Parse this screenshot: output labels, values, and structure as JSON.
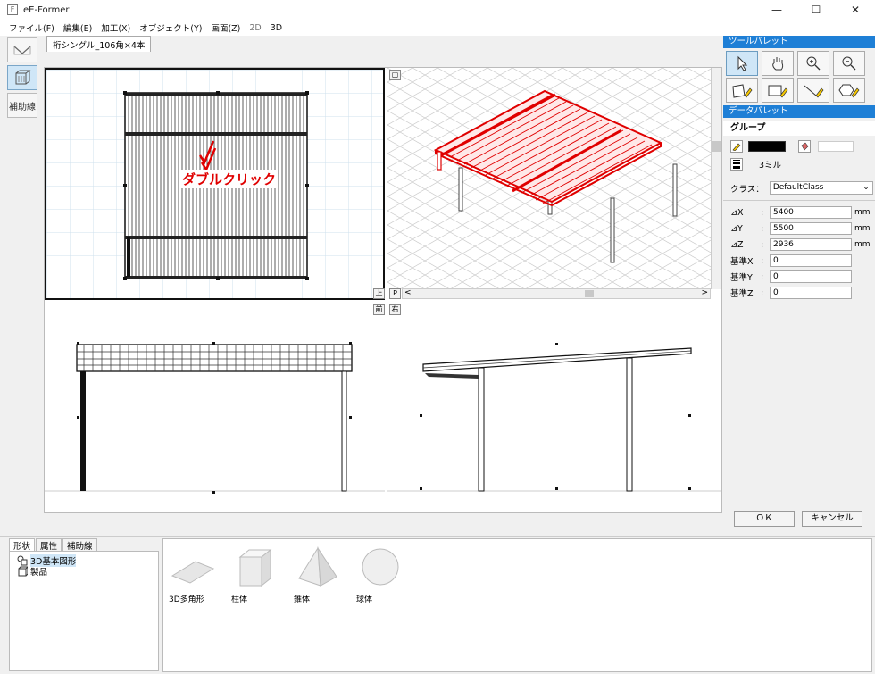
{
  "window": {
    "title": "eE-Former",
    "icon_glyph": "F",
    "minimize": "—",
    "maximize": "☐",
    "close": "✕"
  },
  "menu": {
    "items": [
      "ファイル(F)",
      "編集(E)",
      "加工(X)",
      "オブジェクト(Y)",
      "画面(Z)",
      "2D",
      "3D"
    ]
  },
  "left_tools": {
    "aux_label": "補助線"
  },
  "document_tab": {
    "label": "桁シングル_106角×4本"
  },
  "viewports": {
    "top_label": "上",
    "front_label": "前",
    "right_label": "右",
    "perspective_label": "P",
    "scroll_left": "<",
    "scroll_right": ">",
    "annotation": "ダブルクリック",
    "annotation_color": "#e00000"
  },
  "tool_palette": {
    "title": "ツールパレット"
  },
  "data_palette": {
    "title": "データパレット",
    "group_label": "グループ",
    "line_weight": "3ミル",
    "class_label": "クラス：",
    "class_value": "DefaultClass",
    "fields": [
      {
        "label": "⊿X",
        "value": "5400",
        "unit": "mm"
      },
      {
        "label": "⊿Y",
        "value": "5500",
        "unit": "mm"
      },
      {
        "label": "⊿Z",
        "value": "2936",
        "unit": "mm"
      },
      {
        "label": "基準X",
        "value": "0",
        "unit": ""
      },
      {
        "label": "基準Y",
        "value": "0",
        "unit": ""
      },
      {
        "label": "基準Z",
        "value": "0",
        "unit": ""
      }
    ],
    "ok_label": "ＯＫ",
    "cancel_label": "キャンセル"
  },
  "bottom_tabs": [
    "形状",
    "属性",
    "補助線"
  ],
  "tree": {
    "items": [
      "3D基本図形",
      "製品"
    ]
  },
  "shapes": [
    {
      "label": "3D多角形"
    },
    {
      "label": "柱体"
    },
    {
      "label": "錐体"
    },
    {
      "label": "球体"
    }
  ],
  "colors": {
    "accent": "#1e7fd6",
    "highlight_red": "#e00000",
    "selection": "#cfe6f7"
  }
}
